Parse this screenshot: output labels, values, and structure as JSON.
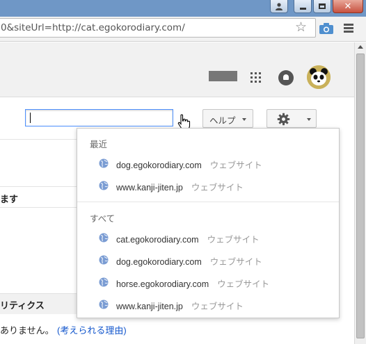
{
  "browser": {
    "url": "0&siteUrl=http://cat.egokorodiary.com/"
  },
  "search": {
    "value": ""
  },
  "help_button": {
    "label": "ヘルプ"
  },
  "background": {
    "row1": "ます",
    "row2": "リティクス",
    "row3": "ありません。",
    "link": "(考えられる理由)"
  },
  "dropdown": {
    "recent_label": "最近",
    "all_label": "すべて",
    "recent": [
      {
        "domain": "dog.egokorodiary.com",
        "type": "ウェブサイト"
      },
      {
        "domain": "www.kanji-jiten.jp",
        "type": "ウェブサイト"
      }
    ],
    "all": [
      {
        "domain": "cat.egokorodiary.com",
        "type": "ウェブサイト"
      },
      {
        "domain": "dog.egokorodiary.com",
        "type": "ウェブサイト"
      },
      {
        "domain": "horse.egokorodiary.com",
        "type": "ウェブサイト"
      },
      {
        "domain": "www.kanji-jiten.jp",
        "type": "ウェブサイト"
      }
    ]
  },
  "colors": {
    "accent": "#4d90fe",
    "link": "#1155cc",
    "titlebar": "#6f97c6"
  }
}
